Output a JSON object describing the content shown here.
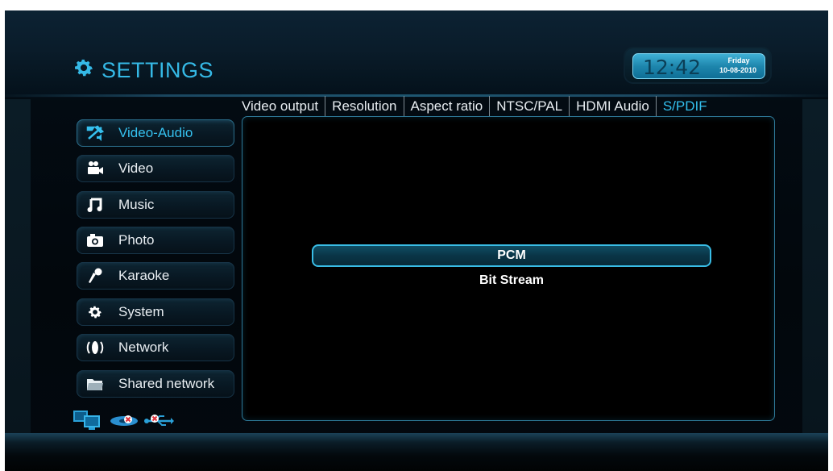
{
  "header": {
    "title": "SETTINGS",
    "title_icon": "gear-icon",
    "clock": {
      "time": "12:42",
      "day": "Friday",
      "date": "10-08-2010"
    }
  },
  "tabs": [
    {
      "label": "Video output",
      "active": false
    },
    {
      "label": "Resolution",
      "active": false
    },
    {
      "label": "Aspect ratio",
      "active": false
    },
    {
      "label": "NTSC/PAL",
      "active": false
    },
    {
      "label": "HDMI Audio",
      "active": false
    },
    {
      "label": "S/PDIF",
      "active": true
    }
  ],
  "menu": [
    {
      "label": "Video-Audio",
      "icon": "video-audio-icon",
      "active": true
    },
    {
      "label": "Video",
      "icon": "video-camera-icon",
      "active": false
    },
    {
      "label": "Music",
      "icon": "music-note-icon",
      "active": false
    },
    {
      "label": "Photo",
      "icon": "camera-icon",
      "active": false
    },
    {
      "label": "Karaoke",
      "icon": "microphone-icon",
      "active": false
    },
    {
      "label": "System",
      "icon": "gear-icon",
      "active": false
    },
    {
      "label": "Network",
      "icon": "network-icon",
      "active": false
    },
    {
      "label": "Shared network",
      "icon": "folder-icon",
      "active": false
    }
  ],
  "options": {
    "selected": "PCM",
    "items": [
      "PCM",
      "Bit Stream"
    ]
  },
  "status_icons": [
    "computer-network-icon",
    "disc-disconnected-icon",
    "usb-disconnected-icon"
  ],
  "colors": {
    "accent": "#35c0ee",
    "text": "#e9eef2",
    "background": "#02070c"
  }
}
